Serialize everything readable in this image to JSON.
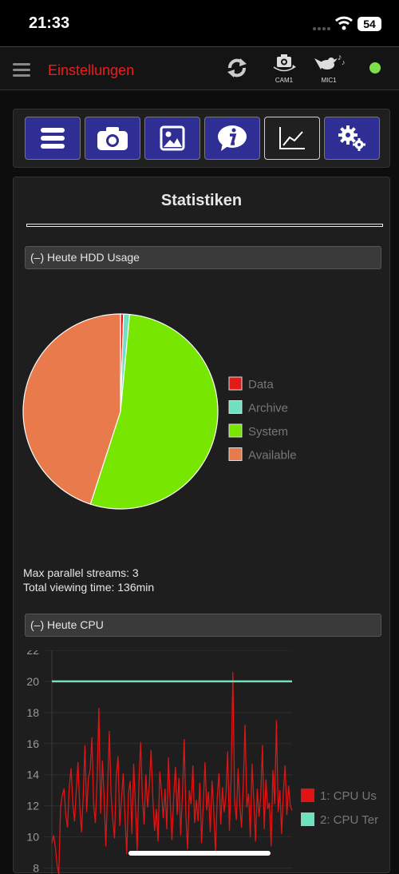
{
  "status_bar": {
    "time": "21:33",
    "battery": "54"
  },
  "app_bar": {
    "title": "Einstellungen",
    "cam_label": "CAM1",
    "mic_label": "MIC1"
  },
  "toolbar": {
    "items": [
      "list-icon",
      "camera-icon",
      "image-icon",
      "info-icon",
      "chart-icon",
      "gears-icon"
    ],
    "active": "chart-icon"
  },
  "panel": {
    "title": "Statistiken",
    "hdd_header": "(–) Heute HDD Usage",
    "cpu_header": "(–) Heute CPU",
    "max_streams": "Max parallel streams: 3",
    "viewing_time": "Total viewing time: 136min"
  },
  "chart_data": [
    {
      "type": "pie",
      "title": "",
      "labels": [
        "Data",
        "Archive",
        "System",
        "Available"
      ],
      "values": [
        0.5,
        1.0,
        53.5,
        45.0
      ],
      "colors": [
        "#e21a1a",
        "#6fe0c0",
        "#77e600",
        "#e87a4c"
      ],
      "legend": "right"
    },
    {
      "type": "line",
      "title": "",
      "ylim": [
        7,
        22
      ],
      "yticks": [
        8,
        10,
        12,
        14,
        16,
        18,
        20,
        22
      ],
      "grid": true,
      "legend": "right",
      "series": [
        {
          "name": "1: CPU Us",
          "color": "#e01414",
          "values": [
            9.6,
            10.1,
            9.3,
            8.2,
            7.6,
            11.9,
            12.7,
            13.1,
            11.4,
            10.6,
            13.2,
            14.4,
            12.2,
            11.0,
            12.9,
            14.8,
            12.0,
            10.3,
            12.6,
            15.9,
            11.6,
            13.8,
            14.3,
            16.4,
            12.1,
            10.9,
            13.7,
            18.3,
            11.5,
            14.9,
            12.6,
            9.4,
            13.0,
            16.8,
            12.7,
            11.1,
            9.9,
            13.9,
            15.2,
            10.7,
            12.4,
            14.1,
            11.3,
            8.9,
            12.8,
            13.6,
            10.2,
            14.7,
            12.0,
            9.1,
            13.5,
            16.1,
            12.6,
            10.8,
            14.0,
            11.9,
            13.3,
            15.6,
            12.5,
            10.4,
            11.8,
            9.7,
            14.2,
            12.9,
            11.2,
            13.1,
            10.5,
            15.1,
            12.3,
            9.8,
            12.6,
            14.5,
            11.4,
            13.8,
            10.1,
            12.7,
            16.3,
            11.5,
            9.2,
            13.0,
            12.1,
            14.6,
            10.9,
            12.4,
            11.0,
            13.5,
            9.6,
            12.2,
            14.8,
            11.7,
            12.9,
            10.3,
            13.6,
            11.8,
            9.0,
            12.5,
            14.1,
            10.8,
            13.2,
            11.6,
            12.7,
            15.5,
            10.4,
            13.9,
            20.6,
            12.3,
            11.1,
            14.4,
            12.0,
            10.6,
            13.4,
            17.2,
            11.9,
            12.8,
            10.0,
            14.7,
            12.4,
            9.7,
            13.1,
            11.3,
            12.6,
            15.9,
            10.5,
            13.7,
            11.8,
            12.2,
            9.4,
            14.3,
            12.1,
            17.5,
            11.6,
            13.0,
            10.2,
            12.9,
            14.6,
            11.4,
            13.3,
            12.0,
            11.7
          ]
        },
        {
          "name": "2: CPU Ter",
          "color": "#6fe0c0",
          "values": [
            20,
            20,
            20,
            20,
            20,
            20,
            20,
            20,
            20,
            20,
            20,
            20,
            20,
            20,
            20,
            20,
            20,
            20,
            20,
            20,
            20,
            20,
            20,
            20,
            20,
            20,
            20,
            20,
            20,
            20,
            20,
            20,
            20,
            20,
            20,
            20,
            20,
            20,
            20,
            20,
            20,
            20,
            20,
            20,
            20,
            20,
            20,
            20,
            20,
            20,
            20,
            20,
            20,
            20,
            20,
            20,
            20,
            20,
            20,
            20,
            20,
            20,
            20,
            20,
            20,
            20,
            20,
            20,
            20,
            20,
            20,
            20,
            20,
            20,
            20,
            20,
            20,
            20,
            20,
            20,
            20,
            20,
            20,
            20,
            20,
            20,
            20,
            20,
            20,
            20,
            20,
            20,
            20,
            20,
            20,
            20,
            20,
            20,
            20,
            20,
            20,
            20,
            20,
            20,
            20,
            20,
            20,
            20,
            20,
            20,
            20,
            20,
            20,
            20,
            20,
            20,
            20,
            20,
            20,
            20,
            20,
            20,
            20,
            20,
            20,
            20,
            20,
            20,
            20,
            20,
            20,
            20,
            20,
            20,
            20,
            20,
            20,
            20,
            20,
            20
          ]
        }
      ]
    }
  ]
}
